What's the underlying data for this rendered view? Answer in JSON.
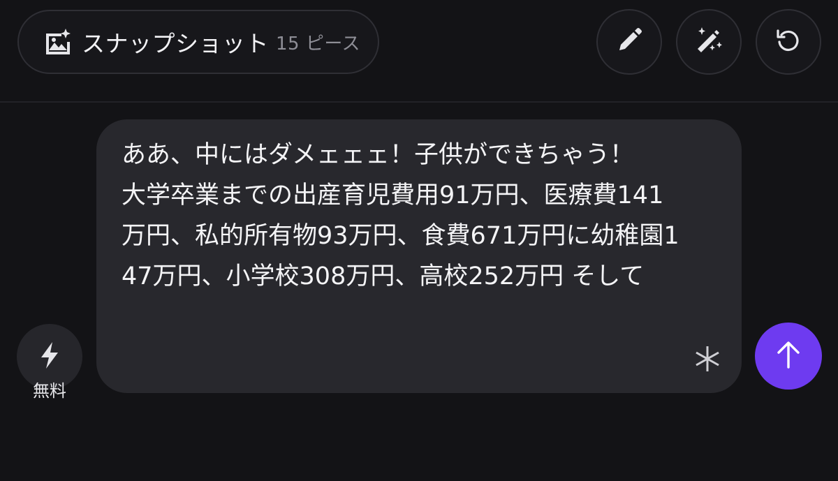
{
  "header": {
    "snapshot": {
      "title": "スナップショット",
      "count": "15 ピース",
      "icon": "image-sparkle-icon"
    },
    "buttons": [
      {
        "icon": "pencil-icon"
      },
      {
        "icon": "magic-wand-icon"
      },
      {
        "icon": "reset-icon"
      }
    ]
  },
  "message": {
    "text": "ああ、中にはダメェェェ！子供ができちゃう！\n大学卒業までの出産育児費用91万円、医療費141万円、私的所有物93万円、食費671万円に幼稚園147万円、小学校308万円、高校252万円 そして"
  },
  "footer": {
    "free_label": "無料",
    "free_icon": "lightning-icon",
    "send_icon": "arrow-up-icon"
  },
  "colors": {
    "background": "#131316",
    "bubble": "#28282d",
    "accent": "#6e3bf0"
  }
}
